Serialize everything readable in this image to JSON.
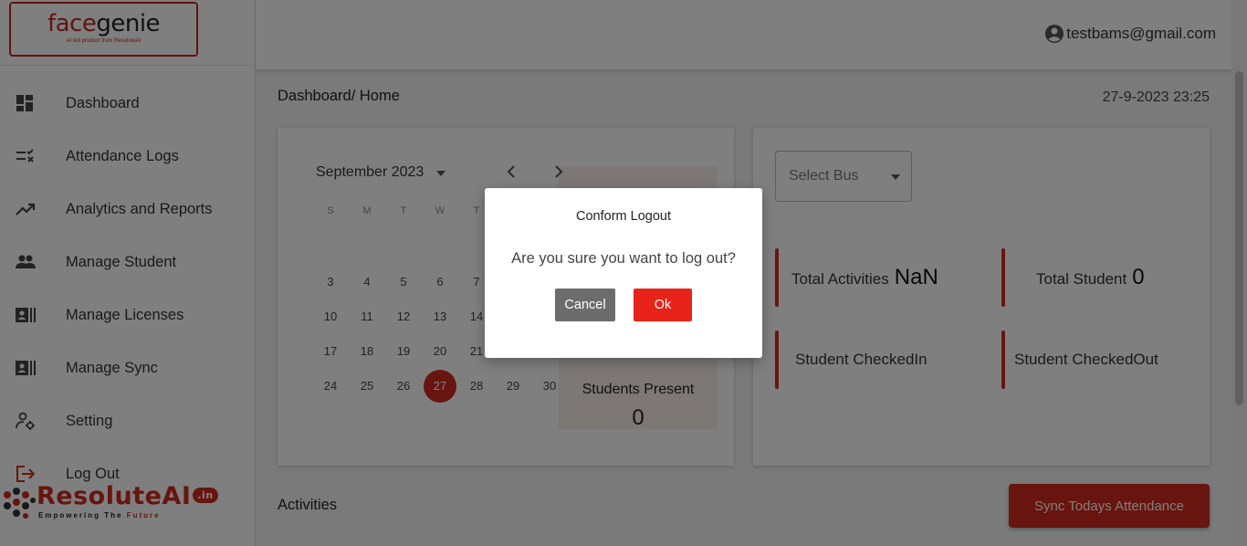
{
  "brand": {
    "logo_part1": "face",
    "logo_part2": "genie",
    "logo_tagline": "AI led product from ResoluteAI",
    "footer_name": "ResoluteAI",
    "footer_tld": ".in",
    "footer_tagline_a": "Empowering  The",
    "footer_tagline_b": "Future"
  },
  "sidebar": {
    "items": [
      {
        "label": "Dashboard",
        "icon": "dashboard-icon"
      },
      {
        "label": "Attendance Logs",
        "icon": "checklist-icon"
      },
      {
        "label": "Analytics and Reports",
        "icon": "trending-up-icon"
      },
      {
        "label": "Manage Student",
        "icon": "people-icon"
      },
      {
        "label": "Manage Licenses",
        "icon": "id-card-icon"
      },
      {
        "label": "Manage Sync",
        "icon": "id-card-icon"
      },
      {
        "label": "Setting",
        "icon": "user-gear-icon"
      },
      {
        "label": "Log Out",
        "icon": "logout-icon"
      }
    ]
  },
  "header": {
    "user_email": "testbams@gmail.com"
  },
  "page": {
    "breadcrumb": "Dashboard/ Home",
    "datetime": "27-9-2023 23:25"
  },
  "calendar": {
    "month_label": "September 2023",
    "weekdays": [
      "S",
      "M",
      "T",
      "W",
      "T"
    ],
    "rows": [
      [
        "3",
        "4",
        "5",
        "6",
        "7"
      ],
      [
        "10",
        "11",
        "12",
        "13",
        "14"
      ],
      [
        "17",
        "18",
        "19",
        "20",
        "21"
      ],
      [
        "24",
        "25",
        "26",
        "27",
        "28",
        "29",
        "30"
      ]
    ],
    "selected_day": "27",
    "present_label": "Students Present",
    "present_value": "0"
  },
  "stats": {
    "select_bus_placeholder": "Select Bus",
    "total_activities_label": "Total Activities",
    "total_activities_value": "NaN",
    "total_student_label": "Total Student",
    "total_student_value": "0",
    "checked_in_label": "Student CheckedIn",
    "checked_out_label": "Student CheckedOut"
  },
  "activities": {
    "title": "Activities",
    "sync_button": "Sync Todays Attendance"
  },
  "modal": {
    "title": "Conform Logout",
    "message": "Are you sure you want to log out?",
    "cancel_label": "Cancel",
    "ok_label": "Ok"
  },
  "colors": {
    "brand_red": "#d12a1f",
    "ok_red": "#e8231a",
    "cancel_gray": "#6c6c6c"
  }
}
